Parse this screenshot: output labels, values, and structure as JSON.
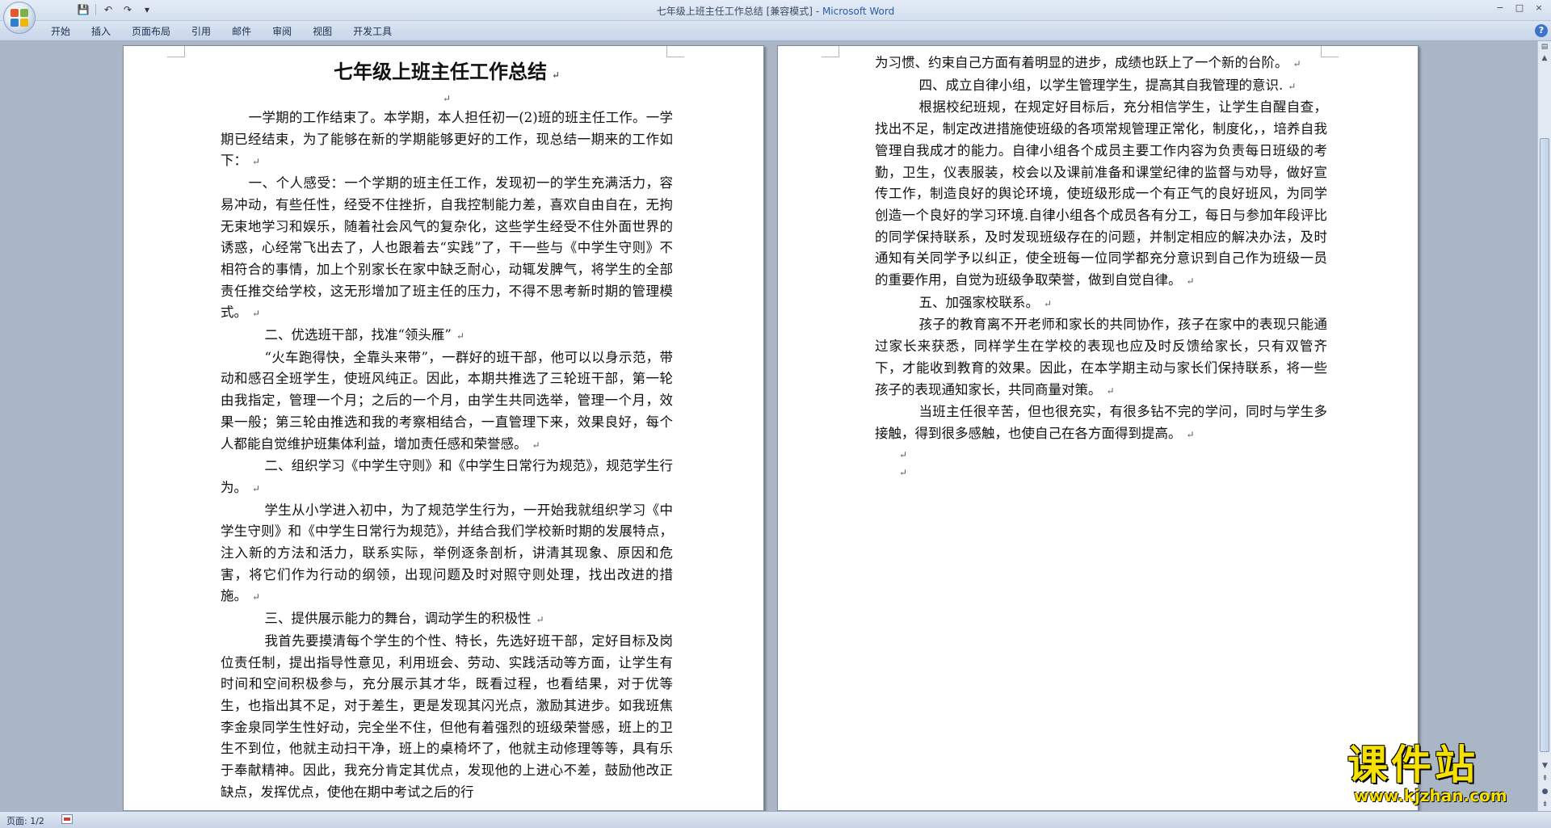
{
  "window": {
    "title_doc": "七年级上班主任工作总结 [兼容模式]",
    "title_sep": " - ",
    "title_app": "Microsoft Word",
    "controls": [
      "−",
      "□",
      "×"
    ]
  },
  "qat": {
    "save": "💾",
    "undo": "↶",
    "redo": "↷",
    "more": "▾"
  },
  "ribbon": {
    "tabs": [
      "开始",
      "插入",
      "页面布局",
      "引用",
      "邮件",
      "审阅",
      "视图",
      "开发工具"
    ],
    "help": "?"
  },
  "document": {
    "title": "七年级上班主任工作总结",
    "page1": {
      "p1": "一学期的工作结束了。本学期，本人担任初一(2)班的班主任工作。一学期已经结束，为了能够在新的学期能够更好的工作，现总结一期来的工作如下：",
      "p2": "一、个人感受：一个学期的班主任工作，发现初一的学生充满活力，容易冲动，有些任性，经受不住挫折，自我控制能力差，喜欢自由自在，无拘无束地学习和娱乐，随着社会风气的复杂化，这些学生经受不住外面世界的诱惑，心经常飞出去了，人也跟着去“实践”了，干一些与《中学生守则》不相符合的事情，加上个别家长在家中缺乏耐心，动辄发脾气，将学生的全部责任推交给学校，这无形增加了班主任的压力，不得不思考新时期的管理模式。",
      "p3": "二、优选班干部，找准“领头雁”",
      "p4": "“火车跑得快，全靠头来带”，一群好的班干部，他可以以身示范，带动和感召全班学生，使班风纯正。因此，本期共推选了三轮班干部，第一轮由我指定，管理一个月；之后的一个月，由学生共同选举，管理一个月，效果一般；第三轮由推选和我的考察相结合，一直管理下来，效果良好，每个人都能自觉维护班集体利益，增加责任感和荣誉感。",
      "p5": "二、组织学习《中学生守则》和《中学生日常行为规范》，规范学生行为。",
      "p6": "学生从小学进入初中，为了规范学生行为，一开始我就组织学习《中学生守则》和《中学生日常行为规范》，并结合我们学校新时期的发展特点，注入新的方法和活力，联系实际，举例逐条剖析，讲清其现象、原因和危害，将它们作为行动的纲领，出现问题及时对照守则处理，找出改进的措施。",
      "p7": "三、提供展示能力的舞台，调动学生的积极性",
      "p8": "我首先要摸清每个学生的个性、特长，先选好班干部，定好目标及岗位责任制，提出指导性意见，利用班会、劳动、实践活动等方面，让学生有时间和空间积极参与，充分展示其才华，既看过程，也看结果，对于优等生，也指出其不足，对于差生，更是发现其闪光点，激励其进步。如我班焦李金泉同学生性好动，完全坐不住，但他有着强烈的班级荣誉感，班上的卫生不到位，他就主动扫干净，班上的桌椅坏了，他就主动修理等等，具有乐于奉献精神。因此，我充分肯定其优点，发现他的上进心不差，鼓励他改正缺点，发挥优点，使他在期中考试之后的行"
    },
    "page2": {
      "p1": "为习惯、约束自己方面有着明显的进步，成绩也跃上了一个新的台阶。",
      "p2": "四、成立自律小组，以学生管理学生，提高其自我管理的意识.",
      "p3": "根据校纪班规，在规定好目标后，充分相信学生，让学生自醒自查，找出不足，制定改进措施使班级的各项常规管理正常化，制度化，，培养自我管理自我成才的能力。自律小组各个成员主要工作内容为负责每日班级的考勤，卫生，仪表服装，校会以及课前准备和课堂纪律的监督与劝导，做好宣传工作，制造良好的舆论环境，使班级形成一个有正气的良好班风，为同学创造一个良好的学习环境.自律小组各个成员各有分工，每日与参加年段评比的同学保持联系，及时发现班级存在的问题，并制定相应的解决办法，及时通知有关同学予以纠正，使全班每一位同学都充分意识到自己作为班级一员的重要作用，自觉为班级争取荣誉，做到自觉自律。",
      "p4": "五、加强家校联系。",
      "p5": "孩子的教育离不开老师和家长的共同协作，孩子在家中的表现只能通过家长来获悉，同样学生在学校的表现也应及时反馈给家长，只有双管齐下，才能收到教育的效果。因此，在本学期主动与家长们保持联系，将一些孩子的表现通知家长，共同商量对策。",
      "p6": "当班主任很辛苦，但也很充实，有很多钻不完的学问，同时与学生多接触，得到很多感触，也使自己在各方面得到提高。"
    },
    "para_mark": "↵"
  },
  "status": {
    "page": "页面: 1/2"
  },
  "watermark": {
    "main": "课件站",
    "url": "www.kjzhan.com"
  }
}
